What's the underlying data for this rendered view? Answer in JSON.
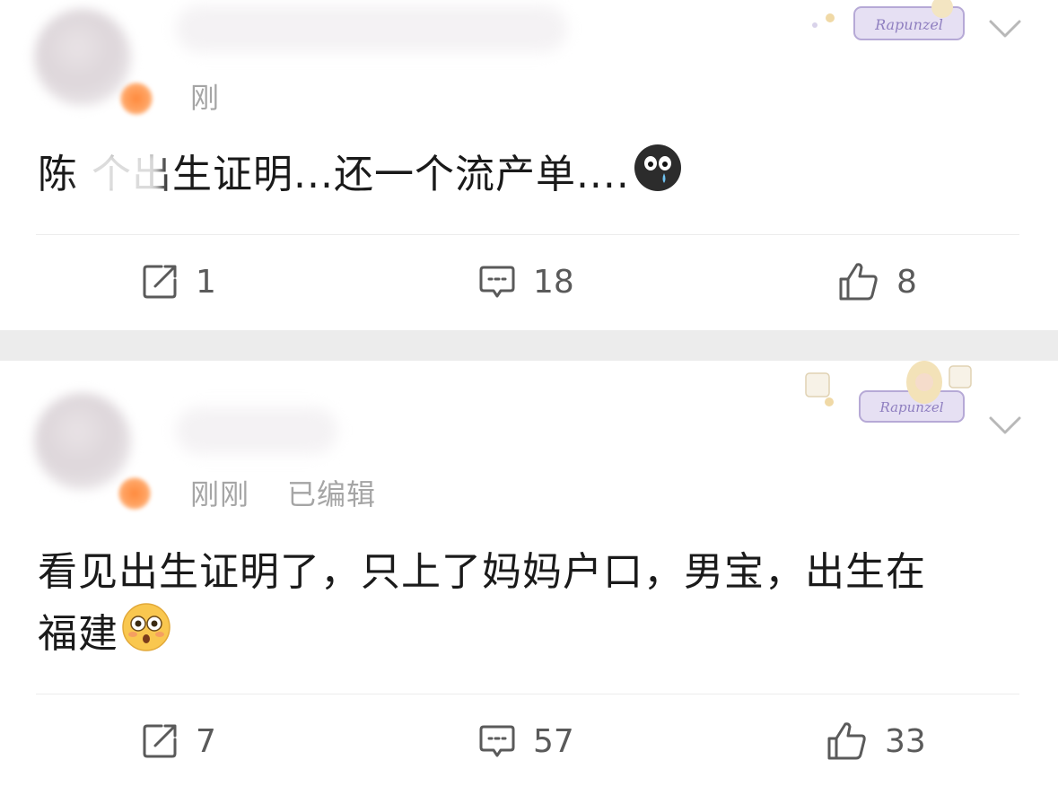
{
  "posts": [
    {
      "time": "刚",
      "edited": "",
      "content": "陈  个出生证明...还一个流产单....",
      "emoji": "crying-face-emoji",
      "stats": {
        "repost": "1",
        "comment": "18",
        "like": "8"
      }
    },
    {
      "time": "刚刚",
      "edited": "已编辑",
      "content_line1": "看见出生证明了，只上了妈妈户口，男宝，出生在",
      "content_line2": "福建",
      "emoji": "flushed-face-emoji",
      "stats": {
        "repost": "7",
        "comment": "57",
        "like": "33"
      }
    }
  ],
  "badge_text": "Rapunzel",
  "colors": {
    "text": "#1a1a1a",
    "meta": "#a5a5a5",
    "icon": "#5a5a5a",
    "separator": "#ececec",
    "vip": "#ff8a3d",
    "badge": "#b6a9d6"
  }
}
